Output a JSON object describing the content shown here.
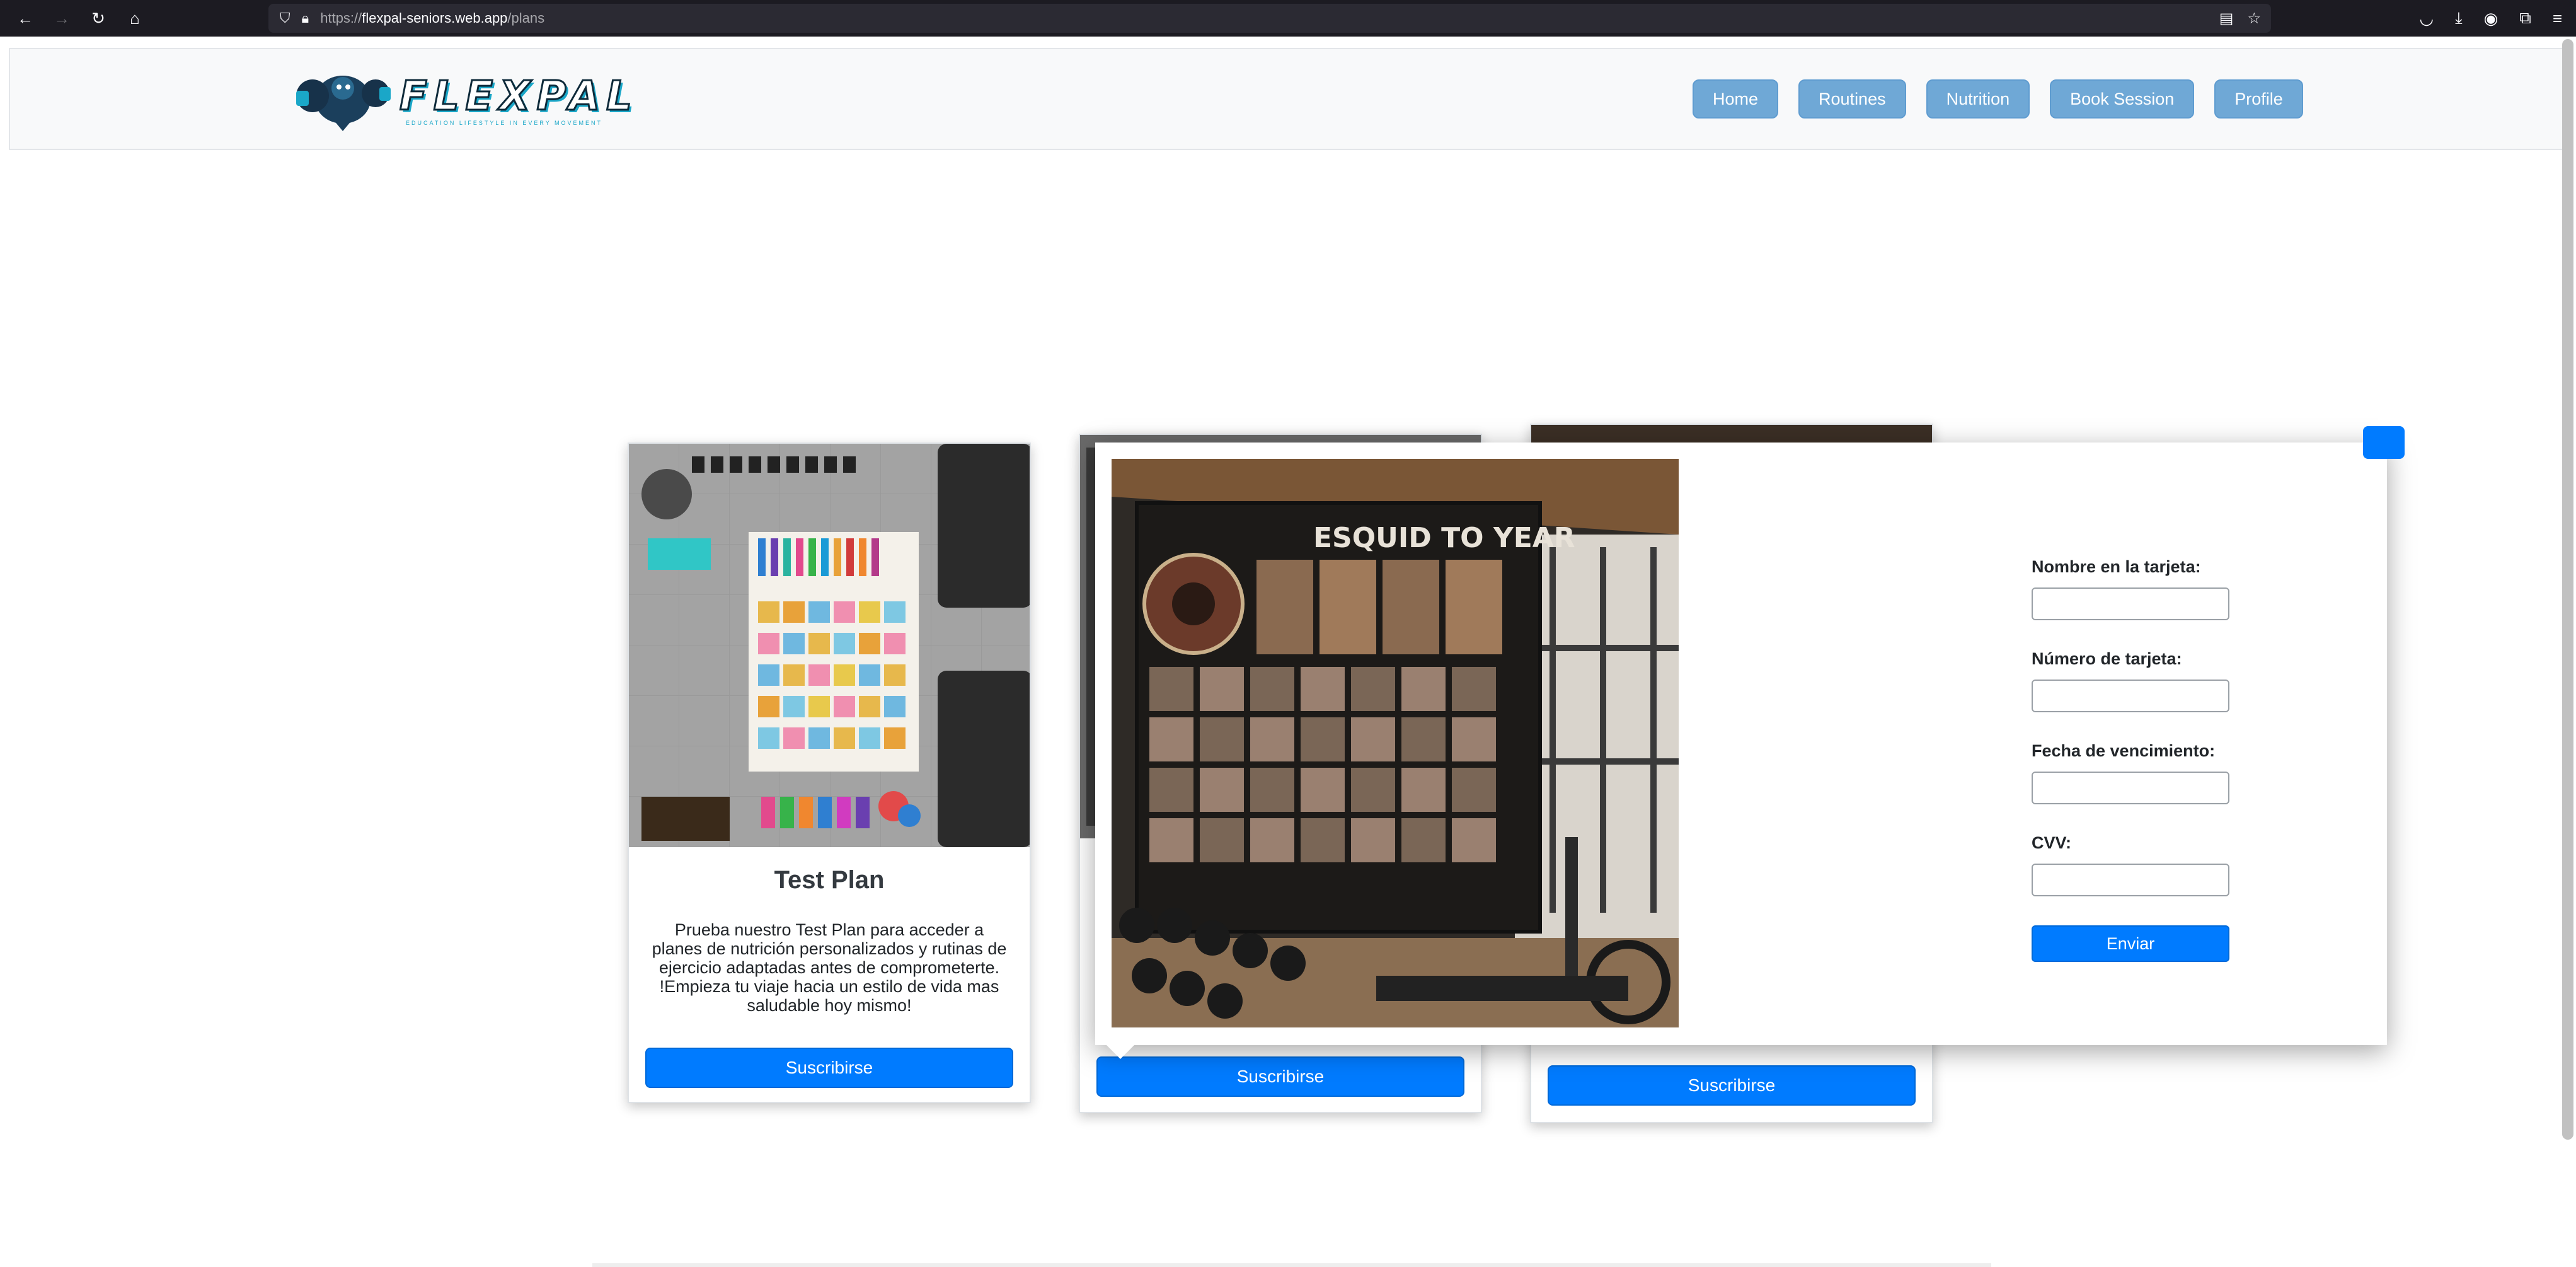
{
  "browser": {
    "url_protocol": "https://",
    "url_host": "flexpal-seniors.web.app",
    "url_path": "/plans"
  },
  "header": {
    "logo_text": "FLEXPAL",
    "logo_tagline": "EDUCATION LIFESTYLE IN EVERY MOVEMENT",
    "nav": [
      "Home",
      "Routines",
      "Nutrition",
      "Book Session",
      "Profile"
    ]
  },
  "plans": [
    {
      "title": "Test Plan",
      "description_line1": "Prueba nuestro Test Plan para acceder a planes de nutrición personalizados y rutinas de ejercicio adaptadas antes de comprometerte.",
      "description_line2": "!Empieza tu viaje hacia un estilo de vida mas saludable hoy mismo!",
      "button": "Suscribirse"
    },
    {
      "button": "Suscribirse"
    },
    {
      "button": "Suscribirse"
    }
  ],
  "modal": {
    "image_caption": "ESQUID TO YEAR",
    "fields": [
      {
        "label": "Nombre en la tarjeta:",
        "value": ""
      },
      {
        "label": "Número de tarjeta:",
        "value": ""
      },
      {
        "label": "Fecha de vencimiento:",
        "value": ""
      },
      {
        "label": "CVV:",
        "value": ""
      }
    ],
    "submit": "Enviar"
  },
  "colors": {
    "primary": "#007bff",
    "nav_button": "#6fa8d6",
    "header_bg": "#f8f9fa",
    "browser_chrome": "#1c1b22"
  }
}
